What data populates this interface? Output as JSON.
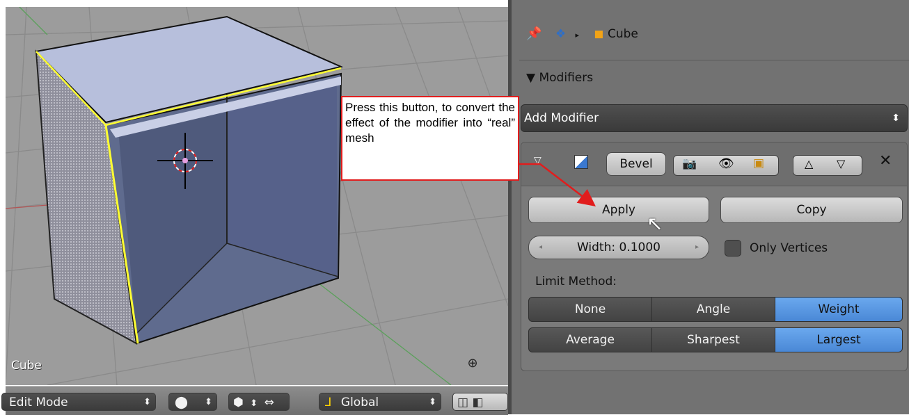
{
  "viewport": {
    "object_label": "Cube",
    "header": {
      "mode": "Edit Mode",
      "orientation": "Global"
    }
  },
  "properties": {
    "breadcrumb": {
      "object": "Cube"
    },
    "panel_title": "Modifiers",
    "add_modifier": "Add Modifier",
    "modifier": {
      "name": "Bevel",
      "apply_label": "Apply",
      "copy_label": "Copy",
      "width_field": "Width: 0.1000",
      "only_vertices_label": "Only Vertices",
      "limit_method_label": "Limit Method:",
      "limit_methods_row1": [
        "None",
        "Angle",
        "Weight"
      ],
      "limit_methods_row2": [
        "Average",
        "Sharpest",
        "Largest"
      ],
      "active_row1": "Weight",
      "active_row2": "Largest"
    }
  },
  "callout": {
    "text": "Press this button, to convert the effect of the modifier into “real” mesh",
    "color": "#e11d1d"
  },
  "colors": {
    "viewport_bg": "#9c9c9c",
    "active_blue": "#5b98e2",
    "selected_edge": "#ffff33"
  }
}
